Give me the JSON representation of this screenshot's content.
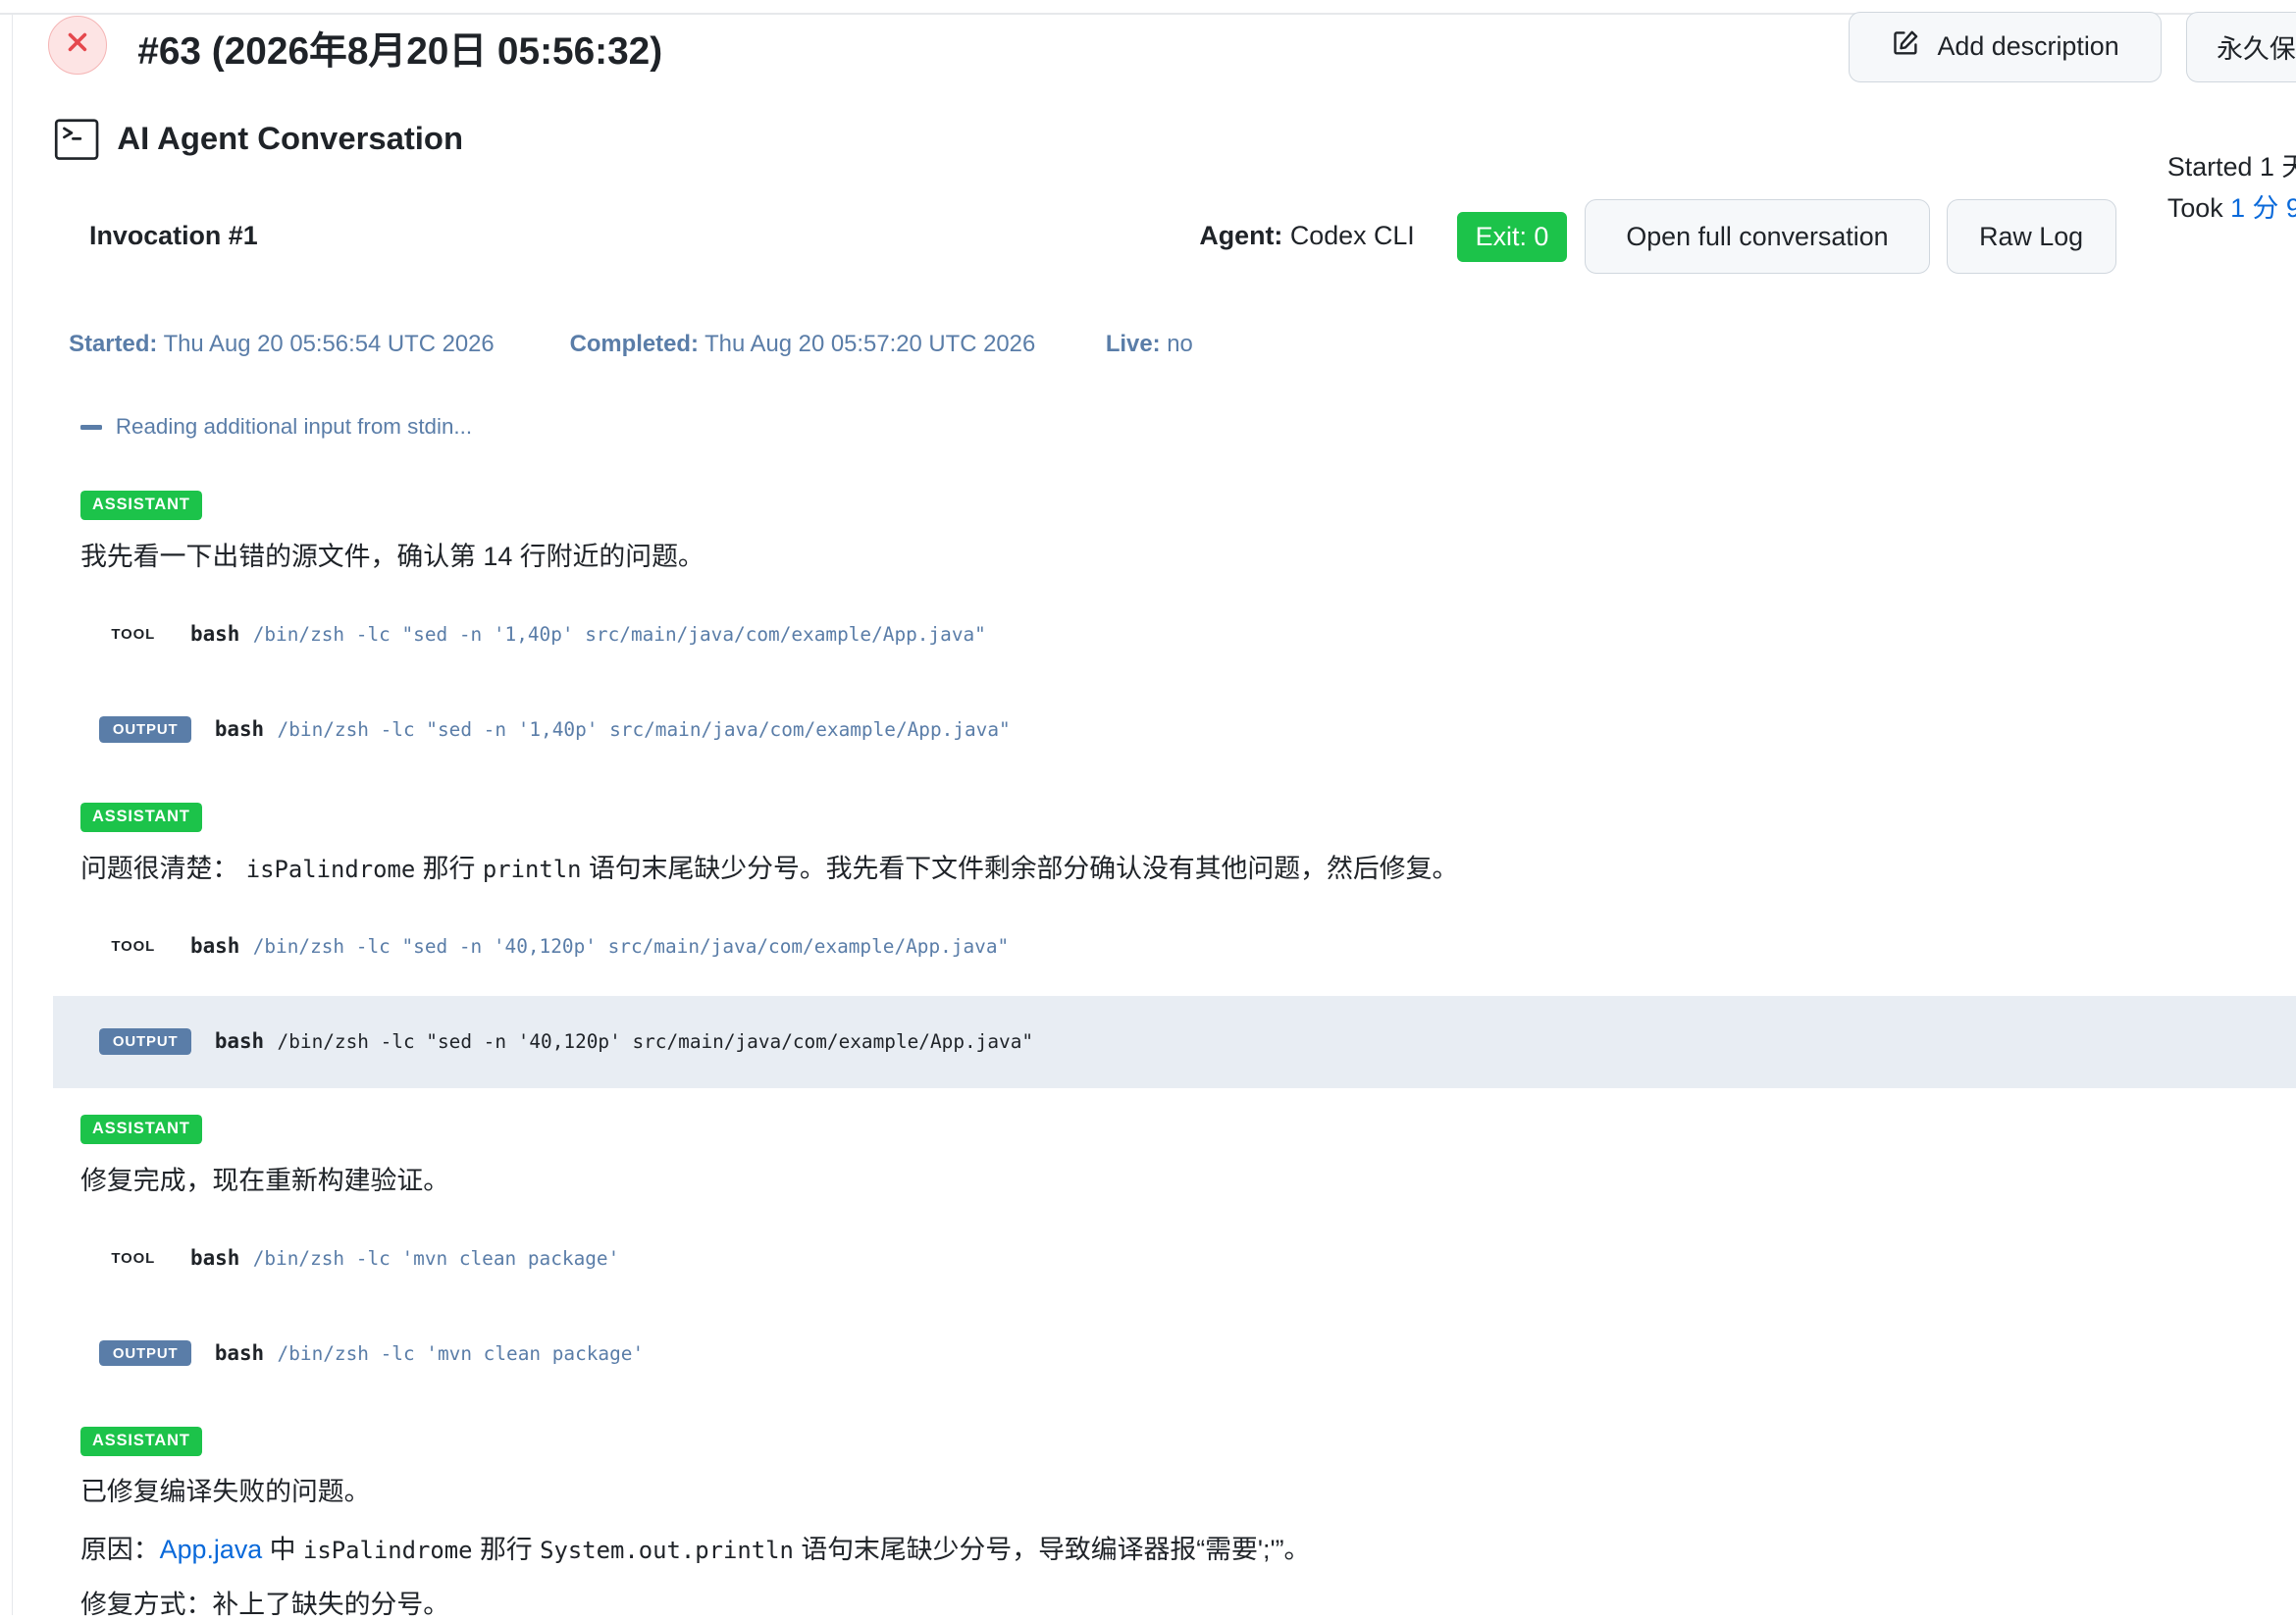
{
  "header": {
    "build_title": "#63 (2026年8月20日 05:56:32)",
    "status_icon": "close-icon",
    "status_color": "#e5484d",
    "add_description": "Add description",
    "keep_label": "永久保",
    "started_label": "Started 1 天",
    "took_label": "Took ",
    "took_value": "1 分 9"
  },
  "section": {
    "icon": "terminal-icon",
    "title": "AI Agent Conversation"
  },
  "invocation": {
    "title": "Invocation #1",
    "agent_label": "Agent:",
    "agent_value": "Codex CLI",
    "exit": "Exit: 0",
    "open_full": "Open full conversation",
    "raw_log": "Raw Log",
    "started_label": "Started:",
    "started_value": "Thu Aug 20 05:56:54 UTC 2026",
    "completed_label": "Completed:",
    "completed_value": "Thu Aug 20 05:57:20 UTC 2026",
    "live_label": "Live:",
    "live_value": "no"
  },
  "log": {
    "stdin_note": "Reading additional input from stdin...",
    "assistant_label": "ASSISTANT",
    "tool_label": "TOOL",
    "output_label": "OUTPUT",
    "bash": "bash",
    "messages": [
      "我先看一下出错的源文件，确认第 14 行附近的问题。",
      "问题很清楚：",
      "isPalindrome",
      "那行",
      "println",
      "语句末尾缺少分号。我先看下文件剩余部分确认没有其他问题，然后修复。",
      "修复完成，现在重新构建验证。",
      "已修复编译失败的问题。",
      "原因：",
      "App.java",
      "中",
      "isPalindrome",
      "那行",
      "System.out.println",
      "语句末尾缺少分号，导致编译器报“需要';'”。",
      "修复方式：补上了缺失的分号。"
    ],
    "commands": [
      "/bin/zsh -lc \"sed -n '1,40p' src/main/java/com/example/App.java\"",
      "/bin/zsh -lc \"sed -n '40,120p' src/main/java/com/example/App.java\"",
      "/bin/zsh -lc 'mvn clean package'"
    ]
  },
  "colors": {
    "assistant_badge": "#1cc34a",
    "output_badge": "#5a7da8",
    "link": "#0969da"
  }
}
